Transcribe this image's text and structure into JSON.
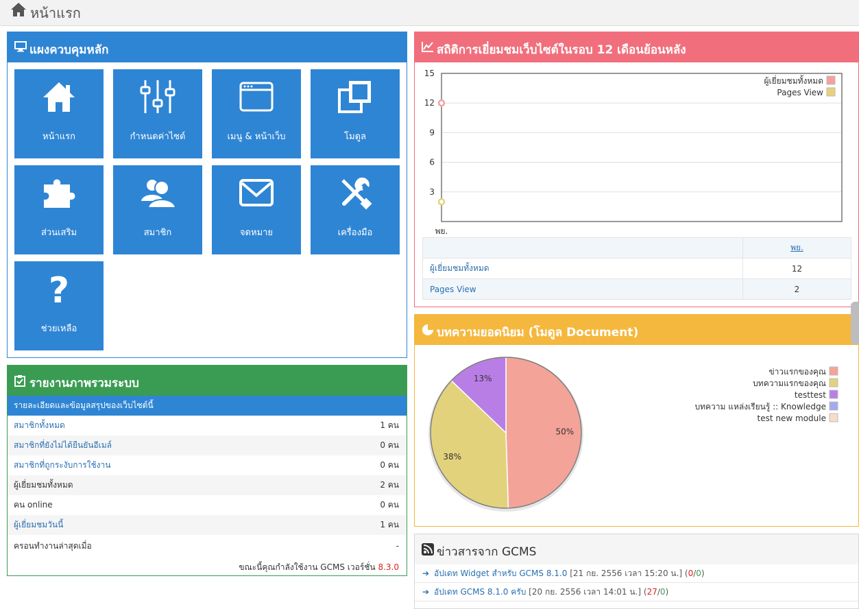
{
  "page": {
    "title": "หน้าแรก"
  },
  "control_panel": {
    "title": "แผงควบคุมหลัก",
    "tiles": [
      {
        "label": "หน้าแรก",
        "icon": "home-icon"
      },
      {
        "label": "กำหนดค่าไซต์",
        "icon": "sliders-icon"
      },
      {
        "label": "เมนู & หน้าเว็บ",
        "icon": "browser-window-icon"
      },
      {
        "label": "โมดูล",
        "icon": "module-windows-icon"
      },
      {
        "label": "ส่วนเสริม",
        "icon": "puzzle-icon"
      },
      {
        "label": "สมาชิก",
        "icon": "users-icon"
      },
      {
        "label": "จดหมาย",
        "icon": "envelope-icon"
      },
      {
        "label": "เครื่องมือ",
        "icon": "tools-icon"
      },
      {
        "label": "ช่วยเหลือ",
        "icon": "question-icon"
      }
    ]
  },
  "system_report": {
    "title": "รายงานภาพรวมระบบ",
    "subtitle": "รายละเอียดและข้อมูลสรุปของเว็บไซต์นี้",
    "rows": [
      {
        "label": "สมาชิกทั้งหมด",
        "value": "1 คน",
        "link": true
      },
      {
        "label": "สมาชิกที่ยังไม่ได้ยืนยันอีเมล์",
        "value": "0 คน",
        "link": true
      },
      {
        "label": "สมาชิกที่ถูกระงับการใช้งาน",
        "value": "0 คน",
        "link": true
      },
      {
        "label": "ผู้เยี่ยมชมทั้งหมด",
        "value": "2 คน",
        "link": false
      },
      {
        "label": "คน online",
        "value": "0 คน",
        "link": false
      },
      {
        "label": "ผู้เยี่ยมชมวันนี้",
        "value": "1 คน",
        "link": true
      },
      {
        "label": "ครอนทำงานล่าสุดเมื่อ",
        "value": "-",
        "link": false
      }
    ],
    "footer_prefix": "ขณะนี้คุณกำลังใช้งาน GCMS เวอร์ชั่น",
    "version": "8.3.0"
  },
  "visitor_stats": {
    "title": "สถิติการเยี่ยมชมเว็บไซต์ในรอบ 12 เดือนย้อนหลัง",
    "table_header": "พย.",
    "table_rows": [
      {
        "label": "ผู้เยี่ยมชมทั้งหมด",
        "value": "12"
      },
      {
        "label": "Pages View",
        "value": "2"
      }
    ]
  },
  "popular_articles": {
    "title": "บทความยอดนิยม (โมดูล Document)"
  },
  "news": {
    "title": "ข่าวสารจาก GCMS",
    "items": [
      {
        "link": "อัปเดท Widget สำหรับ GCMS 8.1.0",
        "meta": "[21 กย. 2556 เวลา 15:20 น.]",
        "count_a": "0",
        "count_b": "0"
      },
      {
        "link": "อัปเดท GCMS 8.1.0 ครับ",
        "meta": "[20 กย. 2556 เวลา 14:01 น.]",
        "count_a": "27",
        "count_b": "0"
      }
    ]
  },
  "chart_data": [
    {
      "type": "line",
      "categories": [
        "พย."
      ],
      "series": [
        {
          "name": "ผู้เยี่ยมชมทั้งหมด",
          "values": [
            12
          ],
          "color": "#f4a0a0"
        },
        {
          "name": "Pages View",
          "values": [
            2
          ],
          "color": "#e6d27a"
        }
      ],
      "yticks": [
        3,
        6,
        9,
        12,
        15
      ],
      "ylim": [
        0,
        15
      ],
      "legend": "top-right",
      "grid": true
    },
    {
      "type": "pie",
      "slices": [
        {
          "name": "ข่าวแรกของคุณ",
          "value": 50,
          "label": "50%",
          "color": "#f4a398"
        },
        {
          "name": "บทความแรกของคุณ",
          "value": 38,
          "label": "38%",
          "color": "#e3d27c"
        },
        {
          "name": "testtest",
          "value": 13,
          "label": "13%",
          "color": "#b87ee6"
        },
        {
          "name": "บทความ แหล่งเรียนรู้ :: Knowledge",
          "value": 0,
          "color": "#a5a9f2"
        },
        {
          "name": "test new module",
          "value": 0,
          "color": "#f6dcc9"
        }
      ],
      "legend": "right"
    }
  ]
}
